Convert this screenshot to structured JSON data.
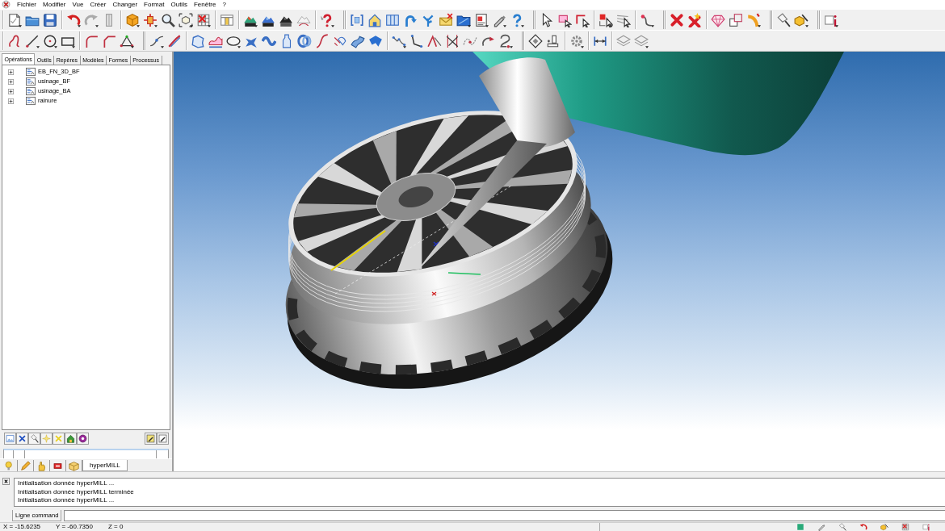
{
  "menu_bar": {
    "items": [
      "Fichier",
      "Modifier",
      "Vue",
      "Créer",
      "Changer",
      "Format",
      "Outils",
      "Fenêtre",
      "?"
    ]
  },
  "left_panel": {
    "tabs": [
      {
        "label": "Opérations",
        "selected": true
      },
      {
        "label": "Outils",
        "selected": false
      },
      {
        "label": "Repères",
        "selected": false
      },
      {
        "label": "Modèles",
        "selected": false
      },
      {
        "label": "Formes",
        "selected": false
      },
      {
        "label": "Processus",
        "selected": false
      }
    ],
    "tree": [
      {
        "label": "EB_FN_3D_BF",
        "expanded": false
      },
      {
        "label": "usinage_BF",
        "expanded": false
      },
      {
        "label": "usinage_BA",
        "expanded": false
      },
      {
        "label": "rainure",
        "expanded": false
      }
    ],
    "bottom_tabs": [
      {
        "selected": false
      },
      {
        "selected": false
      },
      {
        "selected": false
      },
      {
        "selected": false
      },
      {
        "selected": false
      },
      {
        "label": "hyperMILL",
        "selected": true
      }
    ]
  },
  "console": {
    "lines": [
      "Initialisation donnée hyperMILL ...",
      "Initialisation donnée hyperMILL terminée",
      "Initialisation donnée hyperMILL ..."
    ]
  },
  "command_line": {
    "label": "Ligne command"
  },
  "status_bar": {
    "coordinates": [
      "X = -15.6235",
      "Y = -60.7350",
      "Z = 0"
    ]
  }
}
